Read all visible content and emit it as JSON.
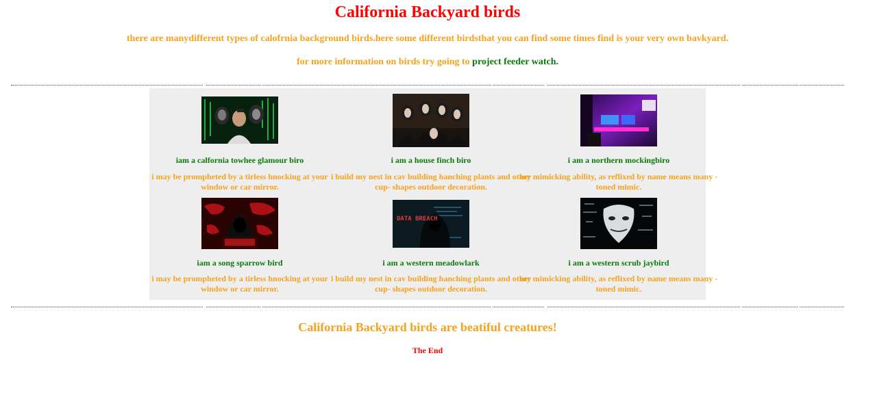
{
  "header": {
    "title": "California Backyard birds",
    "intro": "there are manydifferent types of calofrnia background birds.here some different birdsthat you can find some times find is your very own bavkyard.",
    "more_info_prefix": "for more information on birds try going to ",
    "more_info_link": "project feeder watch."
  },
  "birds": [
    {
      "title": "iam a calfornia towhee glamour biro",
      "description": "i may be prompheted by a tirless hnocking at your window or car mirror.",
      "image_icon": "hacker-group-image-icon"
    },
    {
      "title": "i am a house finch biro",
      "description": "i build my nest in cav building hanching plants and other cup- shapes outdoor decoration.",
      "image_icon": "masked-people-image-icon"
    },
    {
      "title": "i am a northern mockingbiro",
      "description": "my mimicking ability, as reflixed by name means many -toned mimic.",
      "image_icon": "gaming-room-image-icon"
    },
    {
      "title": "iam a song sparrow bird",
      "description": "i may be prompheted by a tirless hnocking at your window or car mirror.",
      "image_icon": "hooded-hacker-map-image-icon"
    },
    {
      "title": "i am a western meadowlark",
      "description": "i build my nest in cav building hanching plants and other cup- shapes outdoor decoration.",
      "image_icon": "data-breach-image-icon",
      "image_text": "DATA BREACH"
    },
    {
      "title": "i am a western scrub jaybird",
      "description": "my mimicking ability, as reflixed by name means many -toned mimic.",
      "image_icon": "anonymous-mask-image-icon"
    }
  ],
  "footer": {
    "tagline": "California Backyard birds are beatiful creatures!",
    "the_end": "The End"
  },
  "colors": {
    "title_red": "#ff0000",
    "text_orange": "#f4a21f",
    "text_green": "#0b7a0b",
    "grid_background": "#eeeeee"
  }
}
